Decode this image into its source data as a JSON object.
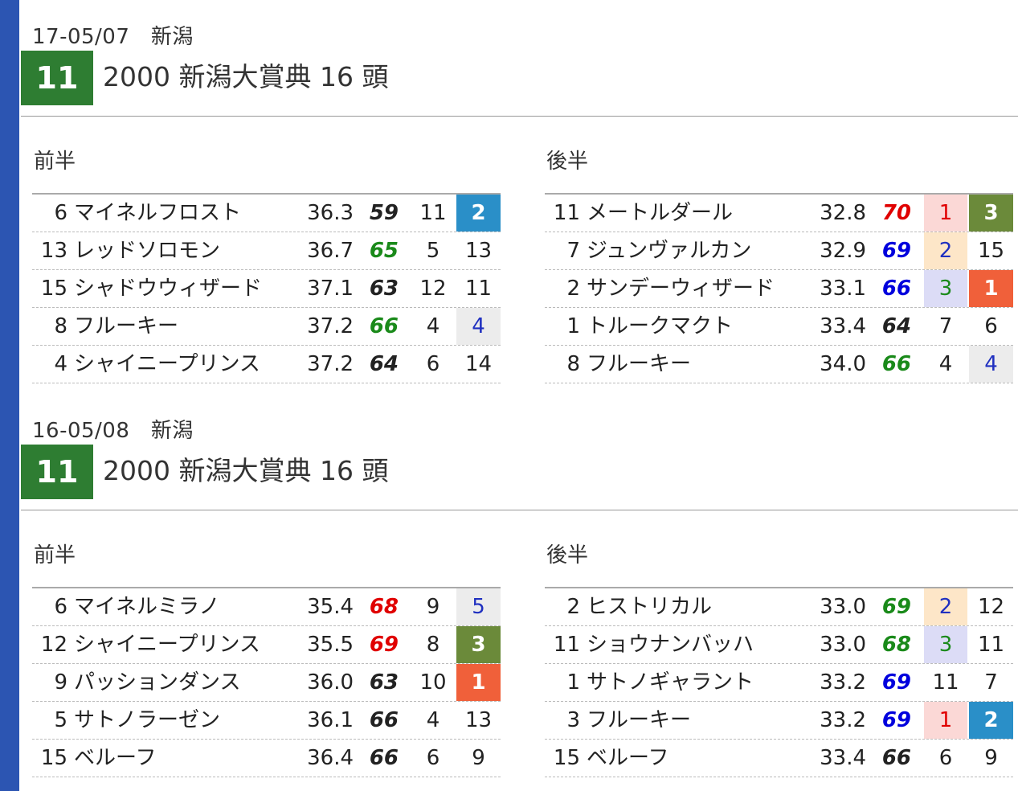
{
  "colors": {
    "sidebar": "#2c55b2",
    "race_badge": "#2e7d32",
    "score": {
      "black": "#222222",
      "red": "#e00000",
      "green": "#1a8a1a",
      "blue": "#0000dd"
    },
    "rank_bg": {
      "blue": "#2a8fc8",
      "olive": "#6b8a3a",
      "red": "#f0603a",
      "lightgray": "#ececec",
      "pink": "#fbd8d6",
      "peach": "#fde6c8",
      "lavender": "#dcdcf6",
      "none": "transparent"
    },
    "rank_fg": {
      "white": "#ffffff",
      "red": "#e00000",
      "blue": "#2030c0",
      "green": "#1a8a1a",
      "black": "#222222"
    }
  },
  "races": [
    {
      "date": "17-05/07　新潟",
      "race_number": "11",
      "title": "2000 新潟大賞典 16 頭",
      "halves": [
        {
          "label": "前半",
          "rows": [
            {
              "no": "6",
              "name": "マイネルフロスト",
              "time": "36.3",
              "score": "59",
              "score_color": "black",
              "pos": "11",
              "rank": "2",
              "rank_bg": "blue",
              "rank_fg": "white",
              "rank_bold": true
            },
            {
              "no": "13",
              "name": "レッドソロモン",
              "time": "36.7",
              "score": "65",
              "score_color": "green",
              "pos": "5",
              "rank": "13",
              "rank_bg": "none",
              "rank_fg": "black",
              "rank_bold": false
            },
            {
              "no": "15",
              "name": "シャドウウィザード",
              "time": "37.1",
              "score": "63",
              "score_color": "black",
              "pos": "12",
              "rank": "11",
              "rank_bg": "none",
              "rank_fg": "black",
              "rank_bold": false
            },
            {
              "no": "8",
              "name": "フルーキー",
              "time": "37.2",
              "score": "66",
              "score_color": "green",
              "pos": "4",
              "rank": "4",
              "rank_bg": "lightgray",
              "rank_fg": "blue",
              "rank_bold": false
            },
            {
              "no": "4",
              "name": "シャイニープリンス",
              "time": "37.2",
              "score": "64",
              "score_color": "black",
              "pos": "6",
              "rank": "14",
              "rank_bg": "none",
              "rank_fg": "black",
              "rank_bold": false
            }
          ]
        },
        {
          "label": "後半",
          "rows": [
            {
              "no": "11",
              "name": "メートルダール",
              "time": "32.8",
              "score": "70",
              "score_color": "red",
              "pos": "1",
              "pos_bg": "pink",
              "pos_fg": "red",
              "rank": "3",
              "rank_bg": "olive",
              "rank_fg": "white",
              "rank_bold": true
            },
            {
              "no": "7",
              "name": "ジュンヴァルカン",
              "time": "32.9",
              "score": "69",
              "score_color": "blue",
              "pos": "2",
              "pos_bg": "peach",
              "pos_fg": "blue",
              "rank": "15",
              "rank_bg": "none",
              "rank_fg": "black",
              "rank_bold": false
            },
            {
              "no": "2",
              "name": "サンデーウィザード",
              "time": "33.1",
              "score": "66",
              "score_color": "blue",
              "pos": "3",
              "pos_bg": "lavender",
              "pos_fg": "green",
              "rank": "1",
              "rank_bg": "red",
              "rank_fg": "white",
              "rank_bold": true
            },
            {
              "no": "1",
              "name": "トルークマクト",
              "time": "33.4",
              "score": "64",
              "score_color": "black",
              "pos": "7",
              "rank": "6",
              "rank_bg": "none",
              "rank_fg": "black",
              "rank_bold": false
            },
            {
              "no": "8",
              "name": "フルーキー",
              "time": "34.0",
              "score": "66",
              "score_color": "green",
              "pos": "4",
              "rank": "4",
              "rank_bg": "lightgray",
              "rank_fg": "blue",
              "rank_bold": false
            }
          ]
        }
      ]
    },
    {
      "date": "16-05/08　新潟",
      "race_number": "11",
      "title": "2000 新潟大賞典 16 頭",
      "halves": [
        {
          "label": "前半",
          "rows": [
            {
              "no": "6",
              "name": "マイネルミラノ",
              "time": "35.4",
              "score": "68",
              "score_color": "red",
              "pos": "9",
              "rank": "5",
              "rank_bg": "lightgray",
              "rank_fg": "blue",
              "rank_bold": false
            },
            {
              "no": "12",
              "name": "シャイニープリンス",
              "time": "35.5",
              "score": "69",
              "score_color": "red",
              "pos": "8",
              "rank": "3",
              "rank_bg": "olive",
              "rank_fg": "white",
              "rank_bold": true
            },
            {
              "no": "9",
              "name": "パッションダンス",
              "time": "36.0",
              "score": "63",
              "score_color": "black",
              "pos": "10",
              "rank": "1",
              "rank_bg": "red",
              "rank_fg": "white",
              "rank_bold": true
            },
            {
              "no": "5",
              "name": "サトノラーゼン",
              "time": "36.1",
              "score": "66",
              "score_color": "black",
              "pos": "4",
              "rank": "13",
              "rank_bg": "none",
              "rank_fg": "black",
              "rank_bold": false
            },
            {
              "no": "15",
              "name": "ベルーフ",
              "time": "36.4",
              "score": "66",
              "score_color": "black",
              "pos": "6",
              "rank": "9",
              "rank_bg": "none",
              "rank_fg": "black",
              "rank_bold": false
            }
          ]
        },
        {
          "label": "後半",
          "rows": [
            {
              "no": "2",
              "name": "ヒストリカル",
              "time": "33.0",
              "score": "69",
              "score_color": "green",
              "pos": "2",
              "pos_bg": "peach",
              "pos_fg": "blue",
              "rank": "12",
              "rank_bg": "none",
              "rank_fg": "black",
              "rank_bold": false
            },
            {
              "no": "11",
              "name": "ショウナンバッハ",
              "time": "33.0",
              "score": "68",
              "score_color": "green",
              "pos": "3",
              "pos_bg": "lavender",
              "pos_fg": "green",
              "rank": "11",
              "rank_bg": "none",
              "rank_fg": "black",
              "rank_bold": false
            },
            {
              "no": "1",
              "name": "サトノギャラント",
              "time": "33.2",
              "score": "69",
              "score_color": "blue",
              "pos": "11",
              "rank": "7",
              "rank_bg": "none",
              "rank_fg": "black",
              "rank_bold": false
            },
            {
              "no": "3",
              "name": "フルーキー",
              "time": "33.2",
              "score": "69",
              "score_color": "blue",
              "pos": "1",
              "pos_bg": "pink",
              "pos_fg": "red",
              "rank": "2",
              "rank_bg": "blue",
              "rank_fg": "white",
              "rank_bold": true
            },
            {
              "no": "15",
              "name": "ベルーフ",
              "time": "33.4",
              "score": "66",
              "score_color": "black",
              "pos": "6",
              "rank": "9",
              "rank_bg": "none",
              "rank_fg": "black",
              "rank_bold": false
            }
          ]
        }
      ]
    }
  ]
}
